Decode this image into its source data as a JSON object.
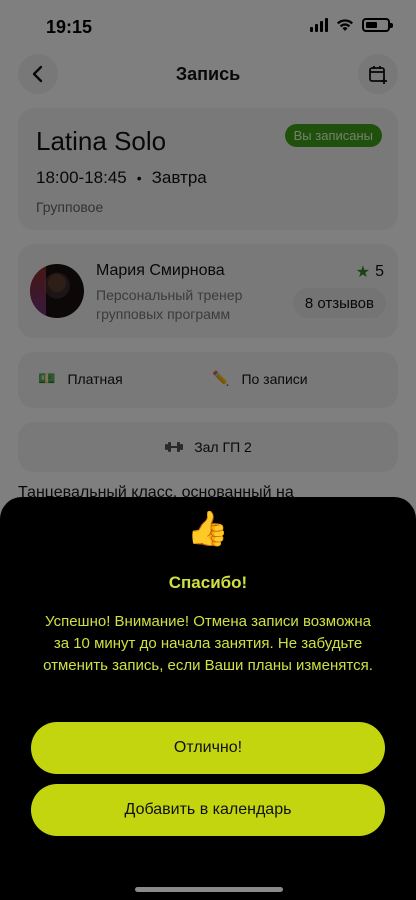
{
  "status_bar": {
    "time": "19:15"
  },
  "nav": {
    "title": "Запись",
    "back_icon": "chevron-left-icon",
    "calendar_icon": "calendar-add-icon"
  },
  "class_card": {
    "title": "Latina Solo",
    "badge": "Вы записаны",
    "time": "18:00-18:45",
    "separator": "•",
    "day": "Завтра",
    "type": "Групповое"
  },
  "trainer": {
    "name": "Мария Смирнова",
    "role": "Персональный тренер групповых программ",
    "rating": "5",
    "reviews": "8 отзывов"
  },
  "info": {
    "payment_icon": "💵",
    "payment": "Платная",
    "booking_icon": "✏️",
    "booking": "По записи"
  },
  "hall": {
    "icon": "dumbbell-icon",
    "label": "Зал ГП 2"
  },
  "description": "Танцевальный класс, основанный на",
  "sheet": {
    "icon": "👍",
    "title": "Спасибо!",
    "message": "Успешно! Внимание! Отмена записи возможна за 10 минут до начала занятия. Не забудьте отменить запись, если Ваши планы изменятся.",
    "ok_label": "Отлично!",
    "calendar_label": "Добавить в календарь"
  },
  "colors": {
    "accent": "#c3d50e",
    "accent_text": "#cfe043",
    "badge_bg": "#3ea019",
    "star": "#2e8b1f"
  }
}
